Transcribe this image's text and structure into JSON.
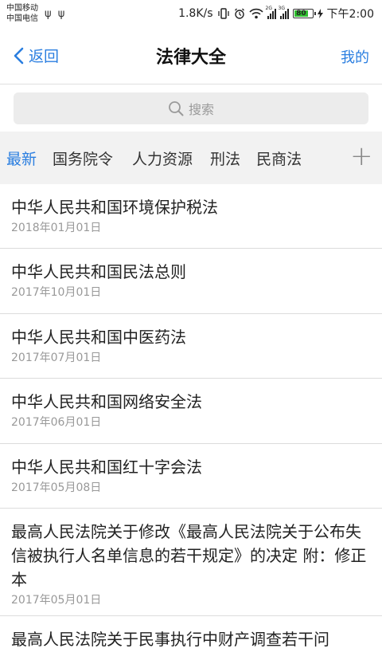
{
  "status_bar": {
    "carrier1": "中国移动",
    "carrier2": "中国电信",
    "usb_icons": "ψ ψ",
    "speed": "1.8K/s",
    "battery": "80",
    "time": "下午2:00"
  },
  "nav": {
    "back_label": "返回",
    "title": "法律大全",
    "right_label": "我的"
  },
  "search": {
    "placeholder": "搜索"
  },
  "tabs": [
    {
      "label": "最新",
      "active": true
    },
    {
      "label": "国务院令",
      "active": false
    },
    {
      "label": "人力资源",
      "active": false
    },
    {
      "label": "刑法",
      "active": false
    },
    {
      "label": "民商法",
      "active": false
    }
  ],
  "tabs_add": "+",
  "colors": {
    "accent": "#2a7ee0",
    "tab_bar_bg": "#f2f2f2",
    "search_bg": "#ececec",
    "date_text": "#999999"
  },
  "items": [
    {
      "title": "中华人民共和国环境保护税法",
      "date": "2018年01月01日"
    },
    {
      "title": "中华人民共和国民法总则",
      "date": "2017年10月01日"
    },
    {
      "title": "中华人民共和国中医药法",
      "date": "2017年07月01日"
    },
    {
      "title": "中华人民共和国网络安全法",
      "date": "2017年06月01日"
    },
    {
      "title": "中华人民共和国红十字会法",
      "date": "2017年05月08日"
    },
    {
      "title": "最高人民法院关于修改《最高人民法院关于公布失信被执行人名单信息的若干规定》的决定 附：修正本",
      "date": "2017年05月01日"
    },
    {
      "title": "最高人民法院关于民事执行中财产调查若干问",
      "date": ""
    }
  ]
}
